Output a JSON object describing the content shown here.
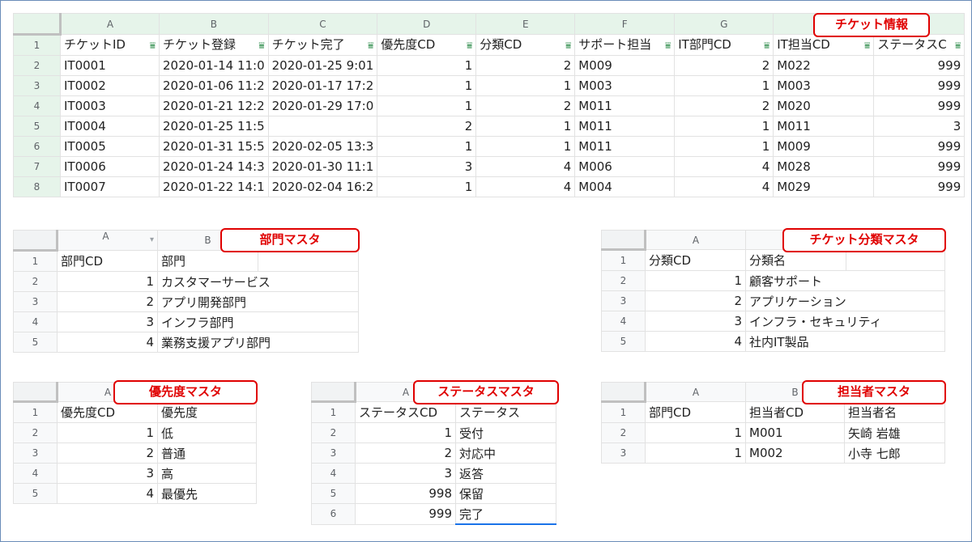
{
  "main": {
    "label": "チケット情報",
    "columns": [
      "A",
      "B",
      "C",
      "D",
      "E",
      "F",
      "G",
      "H",
      "I"
    ],
    "headers": [
      "チケットID",
      "チケット登録",
      "チケット完了",
      "優先度CD",
      "分類CD",
      "サポート担当",
      "IT部門CD",
      "IT担当CD",
      "ステータスC"
    ],
    "rows": [
      {
        "n": "2",
        "c": [
          "IT0001",
          "2020-01-14 11:0",
          "2020-01-25 9:01",
          "1",
          "2",
          "M009",
          "2",
          "M022",
          "999"
        ]
      },
      {
        "n": "3",
        "c": [
          "IT0002",
          "2020-01-06 11:2",
          "2020-01-17 17:2",
          "1",
          "1",
          "M003",
          "1",
          "M003",
          "999"
        ]
      },
      {
        "n": "4",
        "c": [
          "IT0003",
          "2020-01-21 12:2",
          "2020-01-29 17:0",
          "1",
          "2",
          "M011",
          "2",
          "M020",
          "999"
        ]
      },
      {
        "n": "5",
        "c": [
          "IT0004",
          "2020-01-25 11:5",
          "",
          "2",
          "1",
          "M011",
          "1",
          "M011",
          "3"
        ]
      },
      {
        "n": "6",
        "c": [
          "IT0005",
          "2020-01-31 15:5",
          "2020-02-05 13:3",
          "1",
          "1",
          "M011",
          "1",
          "M009",
          "999"
        ]
      },
      {
        "n": "7",
        "c": [
          "IT0006",
          "2020-01-24 14:3",
          "2020-01-30 11:1",
          "3",
          "4",
          "M006",
          "4",
          "M028",
          "999"
        ]
      },
      {
        "n": "8",
        "c": [
          "IT0007",
          "2020-01-22 14:1",
          "2020-02-04 16:2",
          "1",
          "4",
          "M004",
          "4",
          "M029",
          "999"
        ]
      }
    ]
  },
  "dept": {
    "label": "部門マスタ",
    "columns": [
      "A",
      "B"
    ],
    "headers": [
      "部門CD",
      "部門"
    ],
    "rows": [
      {
        "n": "2",
        "c": [
          "1",
          "カスタマーサービス"
        ]
      },
      {
        "n": "3",
        "c": [
          "2",
          "アプリ開発部門"
        ]
      },
      {
        "n": "4",
        "c": [
          "3",
          "インフラ部門"
        ]
      },
      {
        "n": "5",
        "c": [
          "4",
          "業務支援アプリ部門"
        ]
      }
    ]
  },
  "category": {
    "label": "チケット分類マスタ",
    "columns": [
      "A",
      "B"
    ],
    "headers": [
      "分類CD",
      "分類名"
    ],
    "rows": [
      {
        "n": "2",
        "c": [
          "1",
          "顧客サポート"
        ]
      },
      {
        "n": "3",
        "c": [
          "2",
          "アプリケーション"
        ]
      },
      {
        "n": "4",
        "c": [
          "3",
          "インフラ・セキュリティ"
        ]
      },
      {
        "n": "5",
        "c": [
          "4",
          "社内IT製品"
        ]
      }
    ]
  },
  "priority": {
    "label": "優先度マスタ",
    "columns": [
      "A"
    ],
    "headers": [
      "優先度CD",
      "優先度"
    ],
    "rows": [
      {
        "n": "2",
        "c": [
          "1",
          "低"
        ]
      },
      {
        "n": "3",
        "c": [
          "2",
          "普通"
        ]
      },
      {
        "n": "4",
        "c": [
          "3",
          "高"
        ]
      },
      {
        "n": "5",
        "c": [
          "4",
          "最優先"
        ]
      }
    ]
  },
  "status": {
    "label": "ステータスマスタ",
    "columns": [
      "A"
    ],
    "headers": [
      "ステータスCD",
      "ステータス"
    ],
    "rows": [
      {
        "n": "2",
        "c": [
          "1",
          "受付"
        ]
      },
      {
        "n": "3",
        "c": [
          "2",
          "対応中"
        ]
      },
      {
        "n": "4",
        "c": [
          "3",
          "返答"
        ]
      },
      {
        "n": "5",
        "c": [
          "998",
          "保留"
        ]
      },
      {
        "n": "6",
        "c": [
          "999",
          "完了"
        ]
      }
    ]
  },
  "staff": {
    "label": "担当者マスタ",
    "columns": [
      "A",
      "B"
    ],
    "headers": [
      "部門CD",
      "担当者CD",
      "担当者名"
    ],
    "rows": [
      {
        "n": "2",
        "c": [
          "1",
          "M001",
          "矢崎 岩雄"
        ]
      },
      {
        "n": "3",
        "c": [
          "1",
          "M002",
          "小寺 七郎"
        ]
      }
    ]
  },
  "row_header_1": "1",
  "colors": {
    "accent_red": "#e00000",
    "filter_green": "#188038",
    "header_green": "#e6f4ea"
  }
}
